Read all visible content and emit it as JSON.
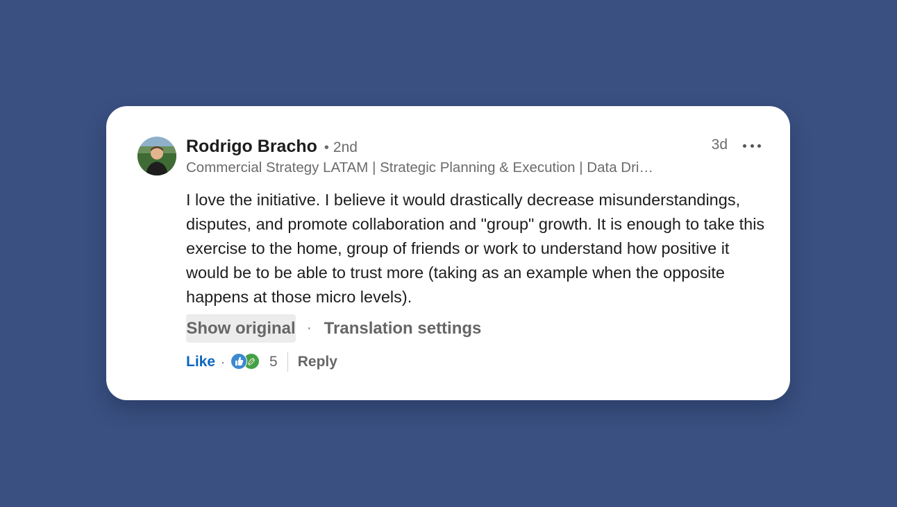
{
  "comment": {
    "author": {
      "name": "Rodrigo Bracho",
      "degree_separator": "•",
      "degree": "2nd",
      "headline": "Commercial Strategy LATAM | Strategic Planning & Execution | Data Dri…"
    },
    "timestamp": "3d",
    "body": "I love the initiative. I believe it would drastically decrease misunderstandings, disputes, and promote collaboration and \"group\" growth. It is enough to take this exercise to the home, group of friends or work to understand how positive it would be to be able to trust more (taking as an example when the opposite happens at those micro levels).",
    "translation": {
      "show_original_label": "Show original",
      "separator": "·",
      "settings_label": "Translation settings"
    },
    "actions": {
      "like_label": "Like",
      "separator": "·",
      "reaction_icons": [
        "like-reaction-icon",
        "celebrate-reaction-icon"
      ],
      "reaction_count": "5",
      "reply_label": "Reply"
    }
  },
  "colors": {
    "background": "#3a5080",
    "card": "#ffffff",
    "like_link": "#0a66c2",
    "muted_text": "#6b6b6b"
  }
}
